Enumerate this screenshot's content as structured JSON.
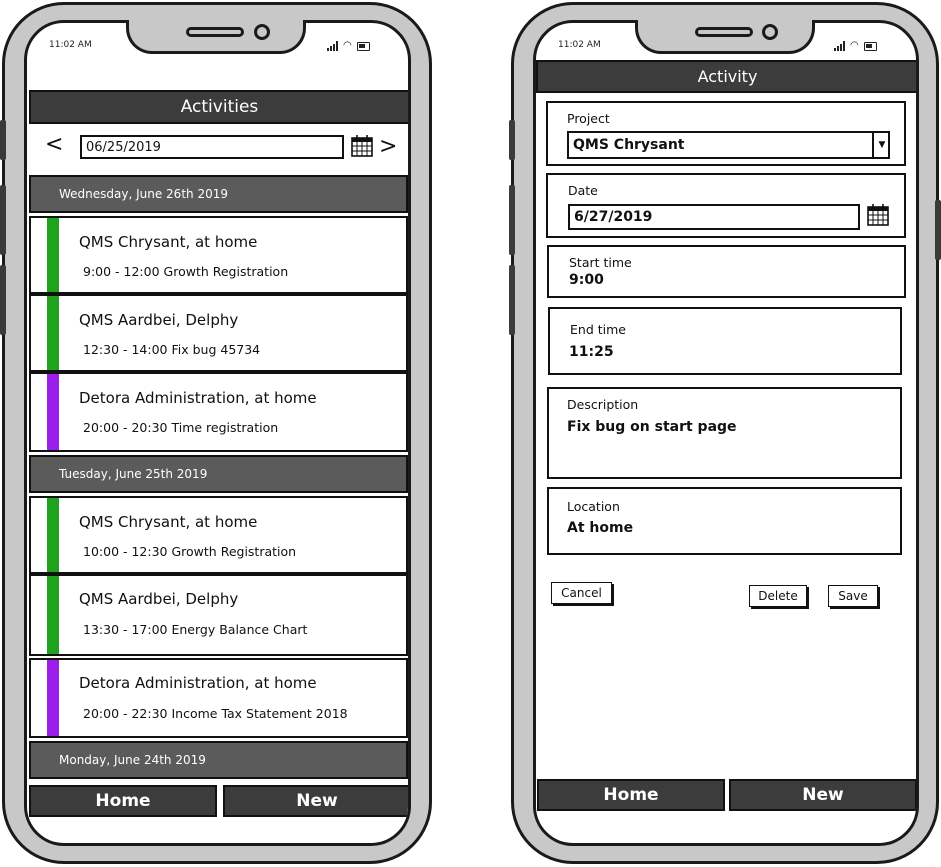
{
  "left": {
    "status_time": "11:02 AM",
    "title": "Activities",
    "nav_prev": "<",
    "nav_next": ">",
    "date_value": "06/25/2019",
    "days": [
      {
        "header": "Wednesday, June 26th 2019",
        "items": [
          {
            "title": "QMS Chrysant, at home",
            "detail": "9:00 - 12:00 Growth Registration",
            "color": "#1fa31f"
          },
          {
            "title": "QMS Aardbei, Delphy",
            "detail": "12:30 - 14:00 Fix bug 45734",
            "color": "#1fa31f"
          },
          {
            "title": "Detora Administration, at home",
            "detail": "20:00 - 20:30 Time registration",
            "color": "#9b1fe8"
          }
        ]
      },
      {
        "header": "Tuesday, June 25th 2019",
        "items": [
          {
            "title": "QMS Chrysant, at home",
            "detail": "10:00 - 12:30 Growth Registration",
            "color": "#1fa31f"
          },
          {
            "title": "QMS Aardbei, Delphy",
            "detail": "13:30 - 17:00 Energy Balance Chart",
            "color": "#1fa31f"
          },
          {
            "title": "Detora Administration, at home",
            "detail": "20:00 - 22:30 Income Tax Statement 2018",
            "color": "#9b1fe8"
          }
        ]
      },
      {
        "header": "Monday, June 24th 2019",
        "items": []
      }
    ],
    "home_label": "Home",
    "new_label": "New"
  },
  "right": {
    "status_time": "11:02 AM",
    "title": "Activity",
    "project_label": "Project",
    "project_value": "QMS Chrysant",
    "date_label": "Date",
    "date_value": "6/27/2019",
    "start_label": "Start time",
    "start_value": "9:00",
    "end_label": "End time",
    "end_value": "11:25",
    "description_label": "Description",
    "description_value": "Fix bug on start page",
    "location_label": "Location",
    "location_value": "At home",
    "cancel_label": "Cancel",
    "delete_label": "Delete",
    "save_label": "Save",
    "home_label": "Home",
    "new_label": "New"
  },
  "colors": {
    "green_bar": "#1fa31f",
    "purple_bar": "#9b1fe8",
    "header_dark": "#3c3c3c",
    "day_header": "#5b5b5b",
    "phone_body": "#c8c8c8"
  }
}
